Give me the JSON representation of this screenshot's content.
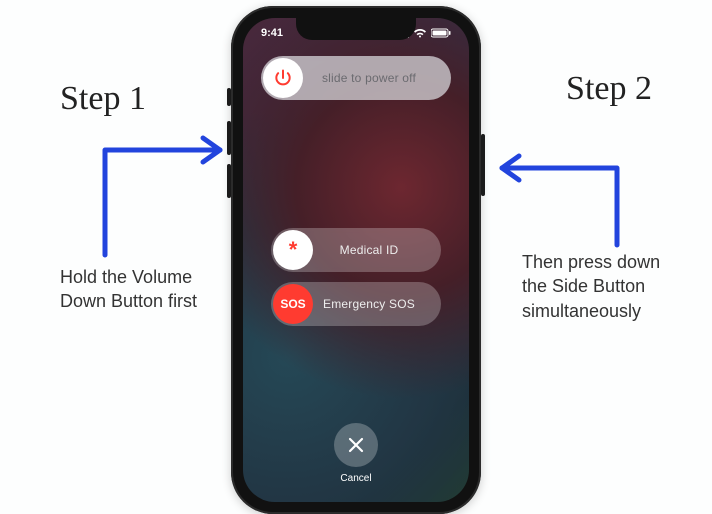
{
  "statusbar": {
    "time": "9:41"
  },
  "sliders": {
    "power": {
      "label": "slide to power off"
    },
    "medical": {
      "label": "Medical ID",
      "knob_text": "*"
    },
    "sos": {
      "label": "Emergency SOS",
      "knob_text": "SOS"
    }
  },
  "cancel": {
    "label": "Cancel"
  },
  "steps": {
    "left": {
      "title": "Step 1",
      "body": "Hold the Volume Down Button first"
    },
    "right": {
      "title": "Step 2",
      "body": "Then press down the Side Button simultaneously"
    }
  }
}
